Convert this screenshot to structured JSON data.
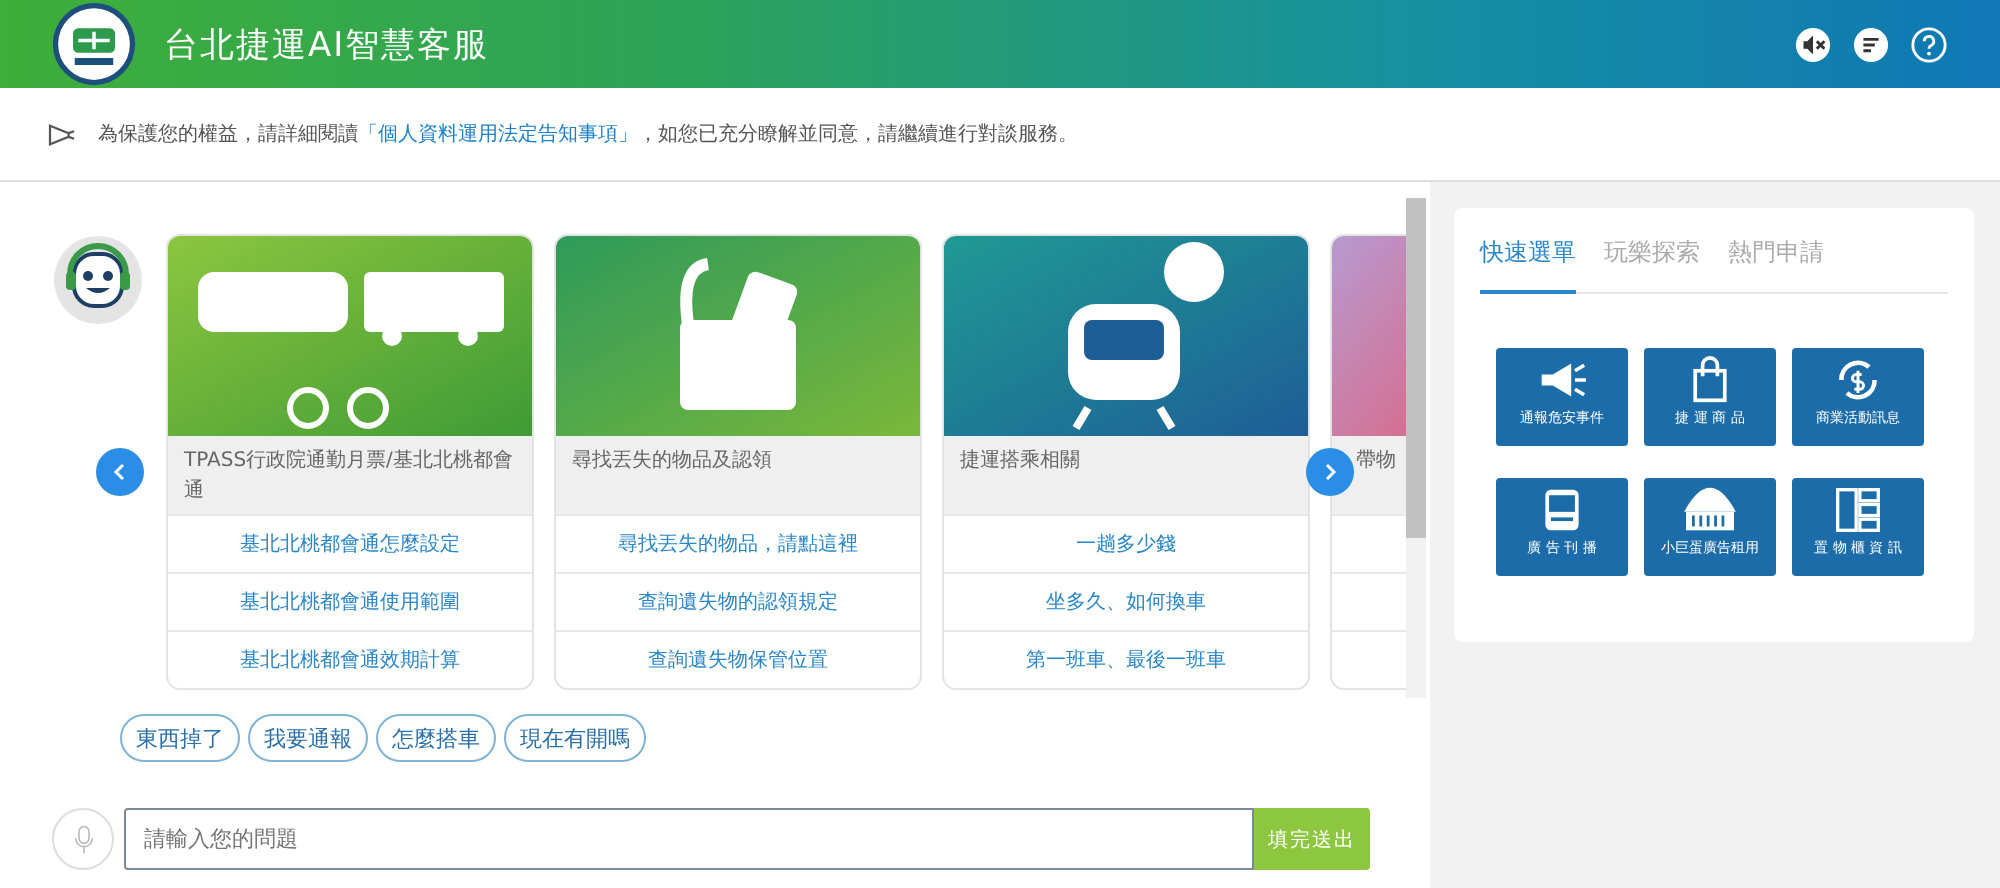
{
  "header": {
    "title": "台北捷運AI智慧客服"
  },
  "notice": {
    "before": "為保護您的權益，請詳細閱讀",
    "link": "「個人資料運用法定告知事項」",
    "after": "，如您已充分瞭解並同意，請繼續進行對談服務。"
  },
  "cards": [
    {
      "kind": "transit",
      "title": "TPASS行政院通勤月票/基北北桃都會通",
      "options": [
        "基北北桃都會通怎麼設定",
        "基北北桃都會通使用範圍",
        "基北北桃都會通效期計算"
      ]
    },
    {
      "kind": "lost",
      "title": "尋找丟失的物品及認領",
      "options": [
        "尋找丟失的物品，請點這裡",
        "查詢遺失物的認領規定",
        "查詢遺失物保管位置"
      ]
    },
    {
      "kind": "train",
      "title": "捷運搭乘相關",
      "options": [
        "一趟多少錢",
        "坐多久、如何換車",
        "第一班車、最後一班車"
      ]
    },
    {
      "kind": "partial",
      "title": "帶物"
    }
  ],
  "chips": [
    "東西掉了",
    "我要通報",
    "怎麼搭車",
    "現在有開嗎"
  ],
  "input": {
    "placeholder": "請輸入您的問題",
    "send": "填完送出"
  },
  "tabs": [
    {
      "label": "快速選單",
      "selected": true
    },
    {
      "label": "玩樂探索",
      "selected": false
    },
    {
      "label": "熱門申請",
      "selected": false
    }
  ],
  "tiles": [
    {
      "kind": "megaphone",
      "label": "通報危安事件"
    },
    {
      "kind": "bag",
      "label": "捷 運 商 品"
    },
    {
      "kind": "money",
      "label": "商業活動訊息"
    },
    {
      "kind": "ad",
      "label": "廣 告 刊 播"
    },
    {
      "kind": "dome",
      "label": "小巨蛋廣告租用"
    },
    {
      "kind": "locker",
      "label": "置 物 櫃 資 訊"
    }
  ]
}
